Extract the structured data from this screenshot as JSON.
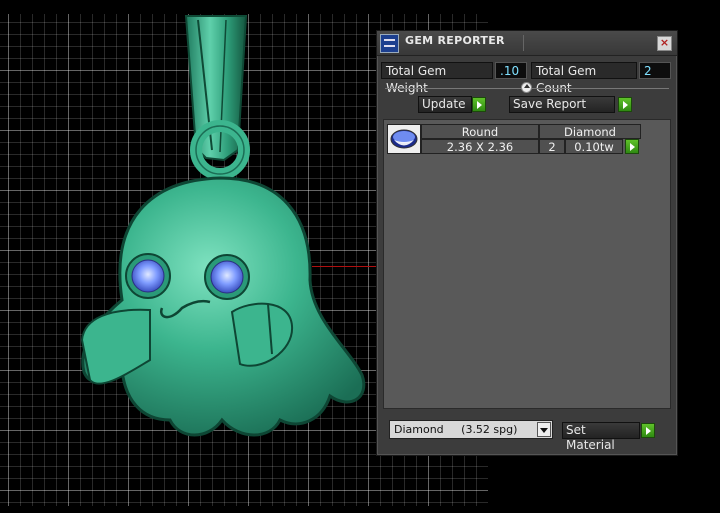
{
  "panel": {
    "title": "GEM REPORTER",
    "close_label": "×",
    "total_weight_label": "Total Gem Weight",
    "total_weight_value": ".10",
    "total_count_label": "Total Gem Count",
    "total_count_value": "2",
    "update_label": "Update",
    "save_report_label": "Save Report"
  },
  "gem_table": {
    "rows": [
      {
        "shape": "Round",
        "material": "Diamond",
        "size": "2.36 X 2.36",
        "count": "2",
        "weight": "0.10tw"
      }
    ]
  },
  "material_select": {
    "value": "Diamond     (3.52 spg)"
  },
  "set_material_label": "Set Material",
  "colors": {
    "model": "#2fa883",
    "gem": "#6e8cf0",
    "panel_bg": "#3c3c3c",
    "value_text": "#7fe0ff",
    "accent_green": "#4cae22"
  }
}
